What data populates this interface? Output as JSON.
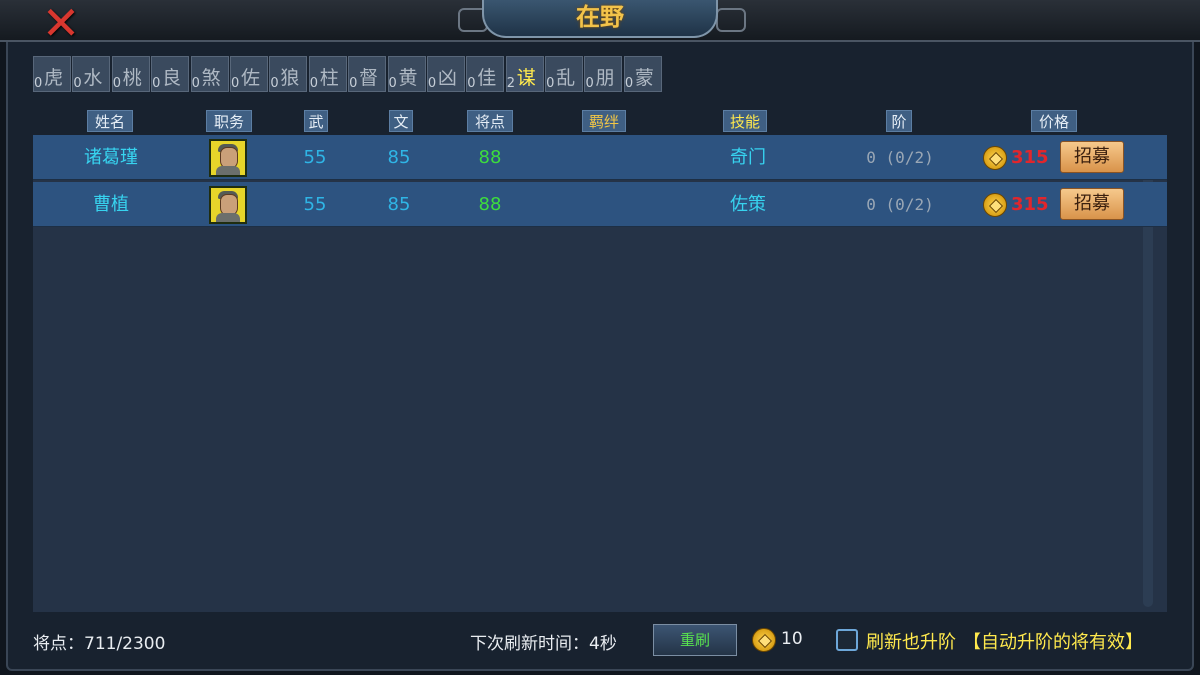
{
  "window": {
    "title": "在野"
  },
  "tabs": [
    {
      "count": "0",
      "label": "虎"
    },
    {
      "count": "0",
      "label": "水"
    },
    {
      "count": "0",
      "label": "桃"
    },
    {
      "count": "0",
      "label": "良"
    },
    {
      "count": "0",
      "label": "煞"
    },
    {
      "count": "0",
      "label": "佐"
    },
    {
      "count": "0",
      "label": "狼"
    },
    {
      "count": "0",
      "label": "柱"
    },
    {
      "count": "0",
      "label": "督"
    },
    {
      "count": "0",
      "label": "黄"
    },
    {
      "count": "0",
      "label": "凶"
    },
    {
      "count": "0",
      "label": "佳"
    },
    {
      "count": "2",
      "label": "谋"
    },
    {
      "count": "0",
      "label": "乱"
    },
    {
      "count": "0",
      "label": "朋"
    },
    {
      "count": "0",
      "label": "蒙"
    }
  ],
  "columns": {
    "name": "姓名",
    "role": "职务",
    "martial": "武",
    "civil": "文",
    "points": "将点",
    "bond": "羁绊",
    "skill": "技能",
    "rank": "阶",
    "price": "价格"
  },
  "rows": [
    {
      "name": "诸葛瑾",
      "martial": "55",
      "civil": "85",
      "points": "88",
      "skill": "奇门",
      "rank": "0 (0/2)",
      "price": "315",
      "recruit_label": "招募"
    },
    {
      "name": "曹植",
      "martial": "55",
      "civil": "85",
      "points": "88",
      "skill": "佐策",
      "rank": "0 (0/2)",
      "price": "315",
      "recruit_label": "招募"
    }
  ],
  "footer": {
    "points_text": "将点：711/2300",
    "next_refresh_text": "下次刷新时间：4秒",
    "refresh_label": "重刷",
    "refresh_cost": "10",
    "checkbox_label": "刷新也升阶",
    "checkbox_note": "【自动升阶的将有效】"
  },
  "colors": {
    "active_tab": "#ffe94d",
    "price": "#e1262c",
    "points": "#3ddd3d"
  }
}
